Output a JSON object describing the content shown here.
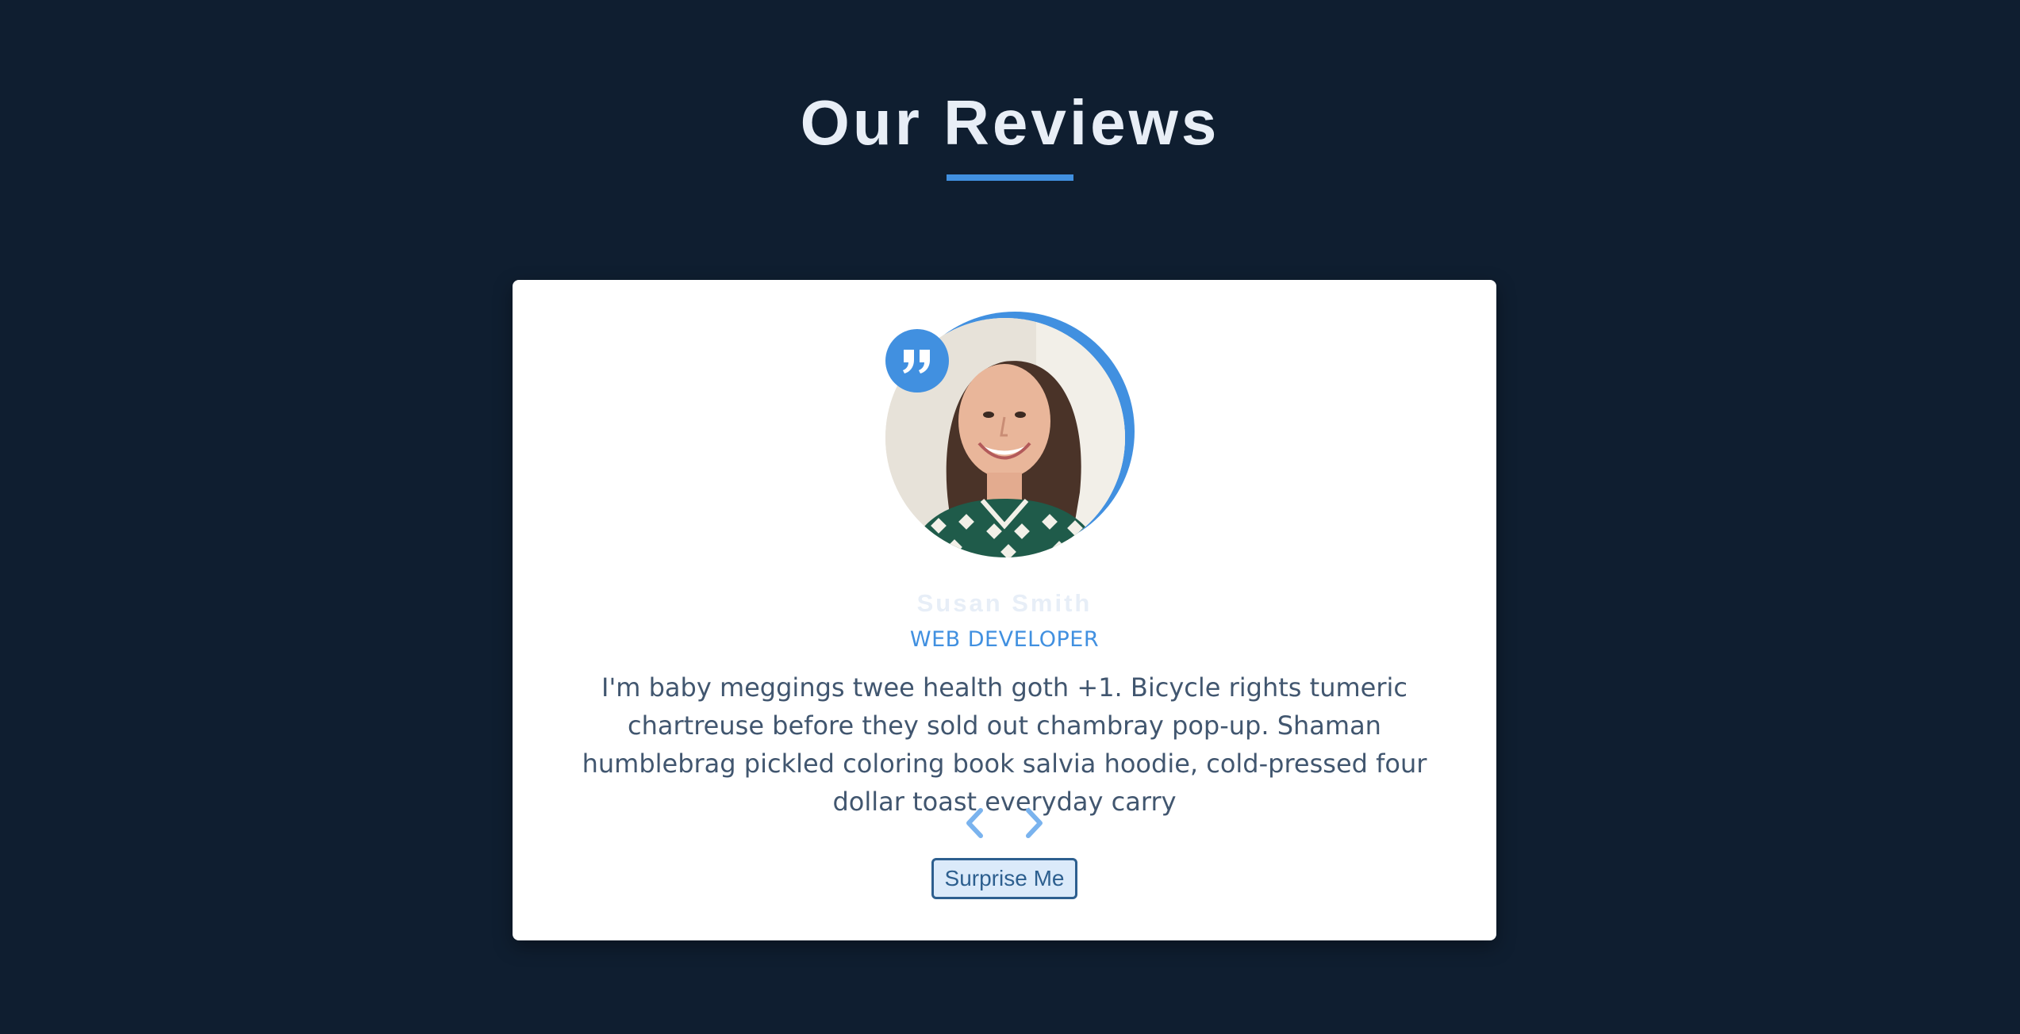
{
  "section": {
    "title": "Our Reviews"
  },
  "review": {
    "author": "Susan Smith",
    "job": "WEB DEVELOPER",
    "text": "I'm baby meggings twee health goth +1. Bicycle rights tumeric chartreuse before they sold out chambray pop-up. Shaman humblebrag pickled coloring book salvia hoodie, cold-pressed four dollar toast everyday carry",
    "avatar_icon": "person-photo",
    "quote_icon": "quote-icon"
  },
  "controls": {
    "prev_icon": "chevron-left-icon",
    "next_icon": "chevron-right-icon",
    "random_label": "Surprise Me"
  },
  "colors": {
    "background": "#0f1e30",
    "card": "#ffffff",
    "accent": "#4190e0",
    "title": "#e8eef6",
    "text": "#41566f",
    "arrow": "#7ab3ee"
  }
}
